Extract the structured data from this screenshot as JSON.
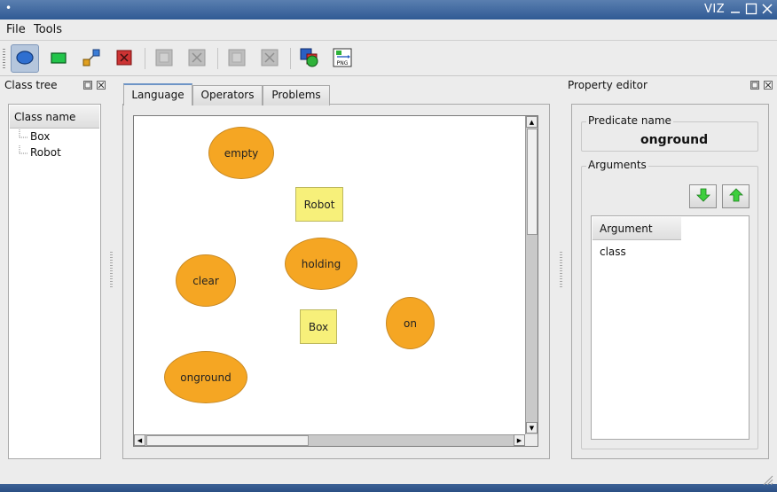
{
  "window": {
    "system_menu_glyph": "•",
    "title": "VIZ"
  },
  "menubar": {
    "items": [
      "File",
      "Tools"
    ]
  },
  "toolbar": {
    "buttons": [
      {
        "icon": "ellipse-tool-icon",
        "active": true
      },
      {
        "icon": "rectangle-tool-icon",
        "active": false
      },
      {
        "icon": "connector-tool-icon",
        "active": false
      },
      {
        "icon": "delete-node-icon",
        "active": false
      },
      {
        "icon": "disabled-remove-icon",
        "active": false
      },
      {
        "icon": "disabled-cancel-icon",
        "active": false
      },
      {
        "icon": "disabled-remove-2-icon",
        "active": false
      },
      {
        "icon": "disabled-cancel-2-icon",
        "active": false
      },
      {
        "icon": "palette-icon",
        "active": false
      },
      {
        "icon": "export-png-icon",
        "active": false
      }
    ],
    "png_label": "PNG"
  },
  "class_tree": {
    "title": "Class tree",
    "header": "Class name",
    "items": [
      "Box",
      "Robot"
    ]
  },
  "tabs": {
    "items": [
      "Language",
      "Operators",
      "Problems"
    ],
    "active": "Language"
  },
  "diagram": {
    "nodes": [
      {
        "label": "empty",
        "shape": "ellipse"
      },
      {
        "label": "Robot",
        "shape": "rect"
      },
      {
        "label": "holding",
        "shape": "ellipse"
      },
      {
        "label": "clear",
        "shape": "ellipse"
      },
      {
        "label": "Box",
        "shape": "rect"
      },
      {
        "label": "on",
        "shape": "ellipse"
      },
      {
        "label": "onground",
        "shape": "ellipse"
      }
    ],
    "colors": {
      "predicate_fill": "#f5a623",
      "class_fill": "#f7f07a"
    }
  },
  "property_editor": {
    "title": "Property editor",
    "predicate_name_label": "Predicate name",
    "predicate_name_value": "onground",
    "arguments_label": "Arguments",
    "argument_column": "Argument class"
  },
  "colors": {
    "title_bar": "#3a659f",
    "arrow_green": "#3ecf3e"
  }
}
